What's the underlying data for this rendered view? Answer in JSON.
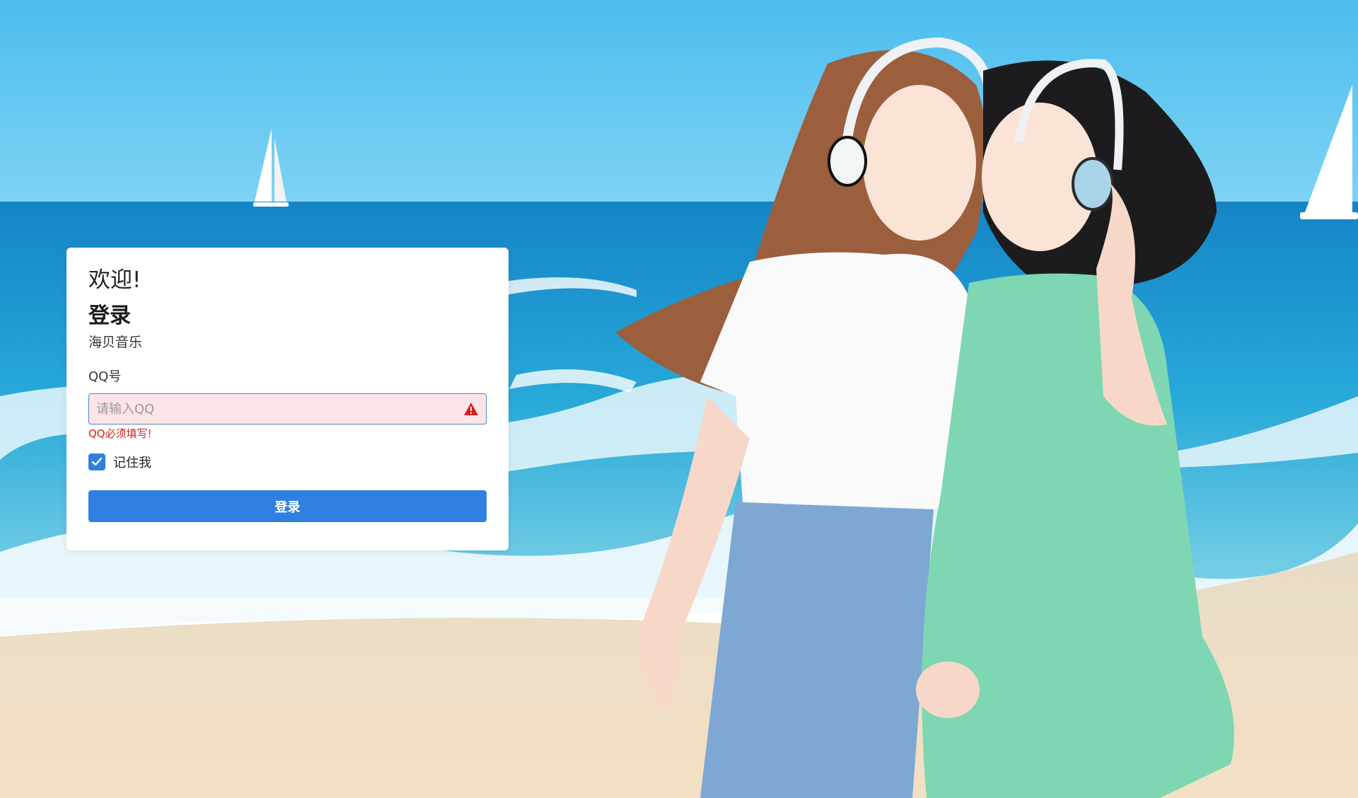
{
  "login_card": {
    "welcome": "欢迎!",
    "title": "登录",
    "app_name": "海贝音乐",
    "qq_label": "QQ号",
    "qq_value": "",
    "qq_placeholder": "请输入QQ",
    "qq_error": "QQ必须填写!",
    "remember_label": "记住我",
    "remember_checked": true,
    "submit_label": "登录"
  },
  "background": {
    "scene": "beach-illustration",
    "colors": {
      "sky": "#4fc1ef",
      "sea": "#1a9fd6",
      "sand": "#f1dfc5"
    }
  },
  "colors": {
    "primary": "#2f80e0",
    "error": "#d42020",
    "input_error_bg": "#fde4e6"
  },
  "icons": {
    "warning": "warning-triangle-icon",
    "check": "checkmark-icon"
  }
}
